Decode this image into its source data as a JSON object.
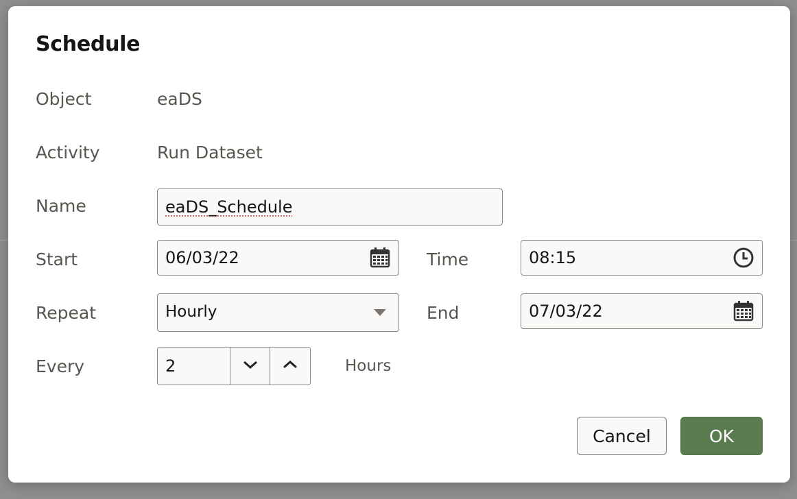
{
  "dialog": {
    "title": "Schedule"
  },
  "rows": {
    "object": {
      "label": "Object",
      "value": "eaDS"
    },
    "activity": {
      "label": "Activity",
      "value": "Run Dataset"
    },
    "name": {
      "label": "Name",
      "value": "eaDS_Schedule"
    },
    "start": {
      "label": "Start",
      "value": "06/03/22",
      "icon": "calendar-icon"
    },
    "time": {
      "label": "Time",
      "value": "08:15",
      "icon": "clock-icon"
    },
    "repeat": {
      "label": "Repeat",
      "value": "Hourly",
      "icon": "triangle-down-icon"
    },
    "end": {
      "label": "End",
      "value": "07/03/22",
      "icon": "calendar-icon"
    },
    "every": {
      "label": "Every",
      "value": "2",
      "unit": "Hours"
    }
  },
  "buttons": {
    "cancel": "Cancel",
    "ok": "OK"
  },
  "colors": {
    "primary": "#5a7a4f",
    "label": "#59554f",
    "text": "#161513",
    "border": "#8b8680"
  }
}
